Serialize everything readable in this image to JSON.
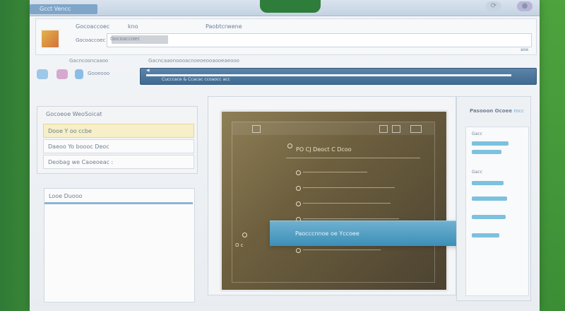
{
  "colors": {
    "accent": "#6fb0d0",
    "highlight": "#f6efc7",
    "brand_green": "#3f8f3a"
  },
  "titlebar": {
    "tab_label": "Gcct Vencc",
    "icons": [
      "refresh-icon",
      "settings-icon"
    ]
  },
  "header": {
    "app_icon": "app-icon",
    "label_1": "Gocoaccoec",
    "label_2": "kno",
    "label_3": "Paobtcrwene",
    "field_hint": "Gocoaccoec",
    "input_placeholder": "Gocoaccoec",
    "scroll_hint": "aoe"
  },
  "toolbar": {
    "label_1": "Gacncosncaaoo",
    "label_2": "Gooeooo",
    "label_3": "Gacncaaonoooacnoeoeooaooeaeooo",
    "progress_label": "Cucccace & Ccacac ccoaocc acc",
    "progress": 0.95
  },
  "left_panel": {
    "title": "Gocoeoe WeoSoicat",
    "items": [
      {
        "label": "Dooe  Y oo  ccbe",
        "selected": true
      },
      {
        "label": "Daeoo  Yo boooc Deoc",
        "selected": false
      },
      {
        "label": "Deobag we Caoeoeac :",
        "selected": false
      }
    ]
  },
  "left_panel2": {
    "header": "Looe Duooo"
  },
  "viewer": {
    "title": "PO CJ Deoct C Dcoo",
    "side_label": "O c",
    "lines": [
      {
        "pct": 0.58
      },
      {
        "pct": 0.83
      },
      {
        "pct": 0.79
      },
      {
        "pct": 0.87
      },
      {
        "pct": 0.75
      },
      {
        "pct": 0.7
      }
    ]
  },
  "banner": {
    "label": "Paocccnnoe oe Yccoee"
  },
  "right_panel": {
    "title": "Pasooon Ocoee",
    "title_accent": "rocc",
    "inner_label_1": "Gacc",
    "inner_label_2": "Gacc",
    "bars": [
      {
        "pct": 0.72
      },
      {
        "pct": 0.58
      },
      {
        "pct": 0.62
      },
      {
        "pct": 0.7
      },
      {
        "pct": 0.66
      },
      {
        "pct": 0.54
      }
    ]
  }
}
